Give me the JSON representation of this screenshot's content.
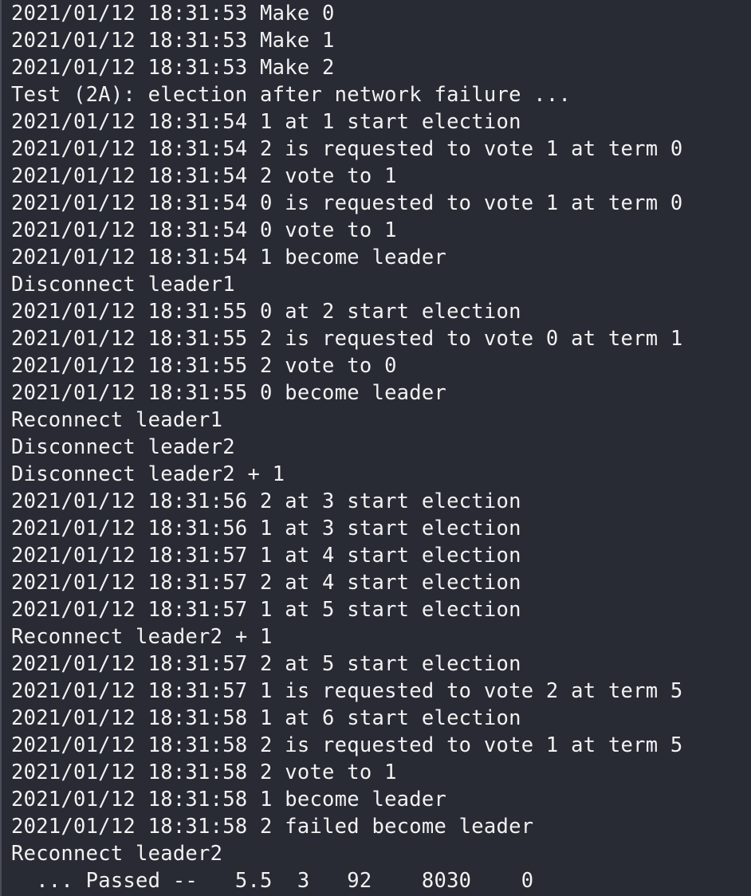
{
  "terminal": {
    "lines": [
      "2021/01/12 18:31:53 Make 0",
      "2021/01/12 18:31:53 Make 1",
      "2021/01/12 18:31:53 Make 2",
      "Test (2A): election after network failure ...",
      "2021/01/12 18:31:54 1 at 1 start election",
      "2021/01/12 18:31:54 2 is requested to vote 1 at term 0",
      "2021/01/12 18:31:54 2 vote to 1",
      "2021/01/12 18:31:54 0 is requested to vote 1 at term 0",
      "2021/01/12 18:31:54 0 vote to 1",
      "2021/01/12 18:31:54 1 become leader",
      "Disconnect leader1",
      "2021/01/12 18:31:55 0 at 2 start election",
      "2021/01/12 18:31:55 2 is requested to vote 0 at term 1",
      "2021/01/12 18:31:55 2 vote to 0",
      "2021/01/12 18:31:55 0 become leader",
      "Reconnect leader1",
      "Disconnect leader2",
      "Disconnect leader2 + 1",
      "2021/01/12 18:31:56 2 at 3 start election",
      "2021/01/12 18:31:56 1 at 3 start election",
      "2021/01/12 18:31:57 1 at 4 start election",
      "2021/01/12 18:31:57 2 at 4 start election",
      "2021/01/12 18:31:57 1 at 5 start election",
      "Reconnect leader2 + 1",
      "2021/01/12 18:31:57 2 at 5 start election",
      "2021/01/12 18:31:57 1 is requested to vote 2 at term 5",
      "2021/01/12 18:31:58 1 at 6 start election",
      "2021/01/12 18:31:58 2 is requested to vote 1 at term 5",
      "2021/01/12 18:31:58 2 vote to 1",
      "2021/01/12 18:31:58 1 become leader",
      "2021/01/12 18:31:58 2 failed become leader",
      "Reconnect leader2",
      "  ... Passed --   5.5  3   92    8030    0"
    ]
  }
}
